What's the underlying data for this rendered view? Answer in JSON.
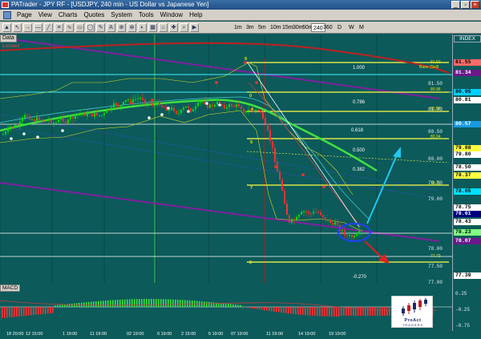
{
  "window": {
    "title": "PATrader - JPY RF - [USDJPY, 240 min - US Dollar vs Japanese Yen]",
    "controls": [
      "_",
      "▫",
      "×"
    ]
  },
  "menu": {
    "items": [
      {
        "label": "Page",
        "key": "P"
      },
      {
        "label": "View",
        "key": "V"
      },
      {
        "label": "Charts",
        "key": "C"
      },
      {
        "label": "Quotes",
        "key": "Q"
      },
      {
        "label": "System",
        "key": "S"
      },
      {
        "label": "Tools",
        "key": "T"
      },
      {
        "label": "Window",
        "key": "W"
      },
      {
        "label": "Help",
        "key": "H"
      }
    ]
  },
  "toolbar": {
    "timeframes": [
      "1m",
      "3m",
      "5m",
      "10m",
      "15m",
      "30m",
      "60m",
      "240",
      "360",
      "D",
      "W",
      "M"
    ],
    "selected": "240"
  },
  "chart": {
    "data_label": "Data",
    "locked_label": "Locked",
    "index_label": "INDEX",
    "price_tags": [
      {
        "value": "81.55",
        "bg": "#ff6a6a",
        "fg": "#000000"
      },
      {
        "value": "81.34",
        "bg": "#6a1a8a",
        "fg": "#ffffff"
      },
      {
        "value": "80.95",
        "bg": "#00d0ff",
        "fg": "#000000"
      },
      {
        "value": "80.81",
        "bg": "#ffffff",
        "fg": "#000000"
      },
      {
        "value": "80.57",
        "bg": "#1a9ae0",
        "fg": "#ffffff"
      },
      {
        "value": "79.88",
        "bg": "#ffff40",
        "fg": "#000000"
      },
      {
        "value": "79.80",
        "bg": "#ffffff",
        "fg": "#000000"
      },
      {
        "value": "78.50",
        "bg": "#ffffff",
        "fg": "#000000"
      },
      {
        "value": "78.37",
        "bg": "#ffff40",
        "fg": "#000000"
      },
      {
        "value": "78.05",
        "bg": "#00e0ff",
        "fg": "#000000"
      },
      {
        "value": "78.75",
        "bg": "#ffffff",
        "fg": "#000000"
      },
      {
        "value": "78.61",
        "bg": "#000080",
        "fg": "#ffffff"
      },
      {
        "value": "78.43",
        "bg": "#ffffff",
        "fg": "#000000"
      },
      {
        "value": "78.23",
        "bg": "#80ff80",
        "fg": "#000000"
      },
      {
        "value": "78.07",
        "bg": "#6a1a8a",
        "fg": "#ffffff"
      },
      {
        "value": "77.39",
        "bg": "#ffffff",
        "fg": "#000000"
      }
    ],
    "price_ticks": [
      "81.50",
      "81.00",
      "80.50",
      "80.00",
      "79.50",
      "79.00",
      "78.00",
      "77.50",
      "77.00"
    ],
    "fib_levels": [
      {
        "label": "1.000"
      },
      {
        "label": "0.786"
      },
      {
        "label": "0.618"
      },
      {
        "label": "0.500"
      },
      {
        "label": "0.382"
      },
      {
        "label": "-0.270"
      }
    ],
    "fib_small_labels": [
      {
        "label": "81.50"
      },
      {
        "label": "Base (Sell)"
      },
      {
        "label": "80.95"
      },
      {
        "label": "80.58"
      },
      {
        "label": "80.04"
      },
      {
        "label": "79.11"
      },
      {
        "label": "77.73"
      }
    ],
    "wave_labels": [
      "0",
      "4",
      "5",
      "7",
      "8",
      "9"
    ],
    "time_ticks": [
      "18 20:00",
      "12 15:00",
      "1 19:00",
      "11 19:00",
      "02 19:00",
      "0 19:00",
      "2 15:00",
      "5 19:00",
      "07 19:00",
      "11 19:00",
      "14 19:00",
      "19 19:00"
    ],
    "macd_label": "MACD",
    "macd_ticks": [
      "0.25",
      "-0.25",
      "-0.75"
    ],
    "colors": {
      "background": "#0c5a5a",
      "up_candle": "#00e000",
      "down_candle": "#ff3030",
      "fib_line": "#ffff40",
      "channel": "#8020a0",
      "ma_red": "#c02020",
      "ma_green": "#40e040",
      "arrow_up": "#20c8f0",
      "arrow_down": "#e02020"
    }
  },
  "logo": {
    "line1": "ProAct",
    "line2": "TRADERS"
  }
}
